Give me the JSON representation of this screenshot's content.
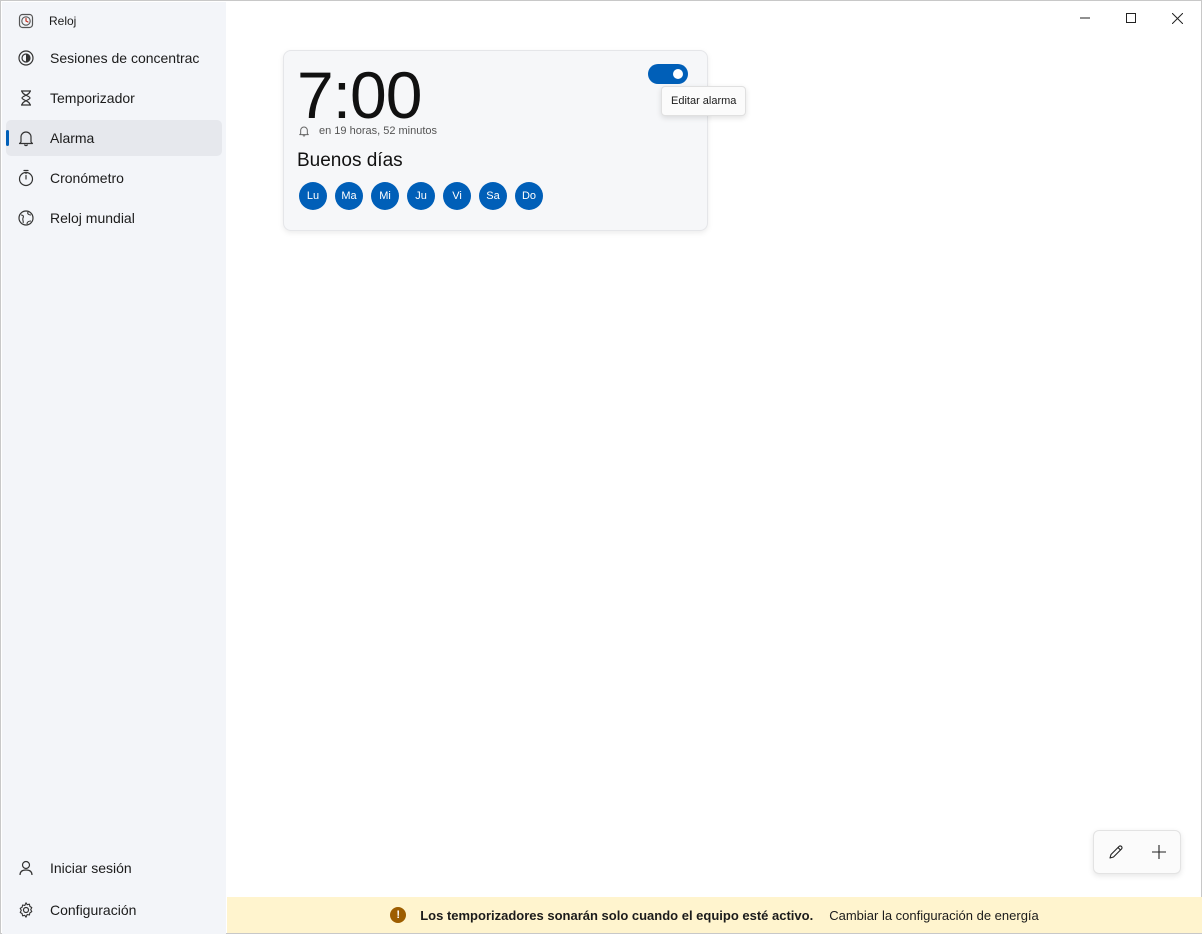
{
  "app": {
    "title": "Reloj"
  },
  "sidebar": {
    "items": [
      {
        "label": "Sesiones de concentración",
        "icon": "focus-icon"
      },
      {
        "label": "Temporizador",
        "icon": "hourglass-icon"
      },
      {
        "label": "Alarma",
        "icon": "bell-icon",
        "active": true
      },
      {
        "label": "Cronómetro",
        "icon": "stopwatch-icon"
      },
      {
        "label": "Reloj mundial",
        "icon": "globe-icon"
      }
    ],
    "bottom": [
      {
        "label": "Iniciar sesión",
        "icon": "person-icon"
      },
      {
        "label": "Configuración",
        "icon": "gear-icon"
      }
    ]
  },
  "alarm": {
    "time": "7:00",
    "remaining": "en 19 horas, 52 minutos",
    "name": "Buenos días",
    "enabled": true,
    "days": [
      "Lu",
      "Ma",
      "Mi",
      "Ju",
      "Vi",
      "Sa",
      "Do"
    ]
  },
  "tooltip": {
    "text": "Editar alarma"
  },
  "infobar": {
    "message": "Los temporizadores sonarán solo cuando el equipo esté activo.",
    "link": "Cambiar la configuración de energía"
  },
  "colors": {
    "accent": "#005fb8",
    "sidebar_bg": "#f3f5f9",
    "infobar_bg": "#fff4ce",
    "warning": "#9d5d00"
  }
}
